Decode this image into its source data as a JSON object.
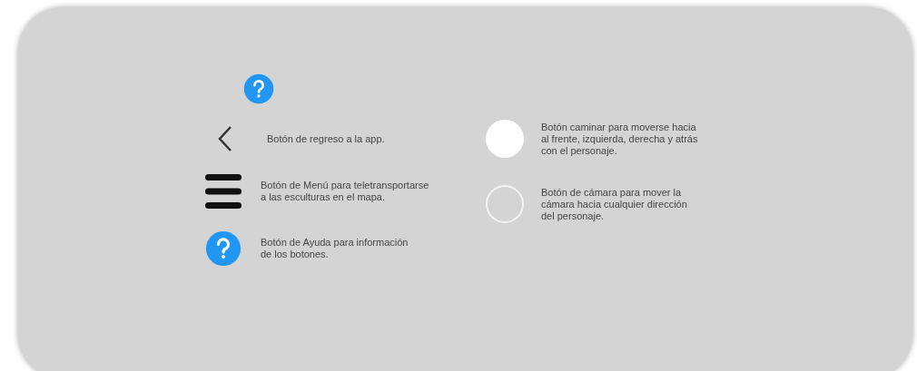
{
  "top_icon": {
    "kind": "help"
  },
  "left_items": [
    {
      "kind": "back",
      "lines": [
        "Botón de regreso a la app."
      ]
    },
    {
      "kind": "menu",
      "lines": [
        "Botón de Menú para teletransportarse",
        "a las esculturas en el mapa."
      ]
    },
    {
      "kind": "help",
      "lines": [
        "Botón de Ayuda para información",
        "de los botones."
      ]
    }
  ],
  "right_items": [
    {
      "kind": "walk",
      "lines": [
        "Botón caminar para moverse hacia",
        "al frente, izquierda, derecha y atrás",
        "con el personaje."
      ]
    },
    {
      "kind": "camera",
      "lines": [
        "Botón de cámara para mover la",
        "cámara hacia cualquier dirección",
        "del personaje."
      ]
    }
  ]
}
